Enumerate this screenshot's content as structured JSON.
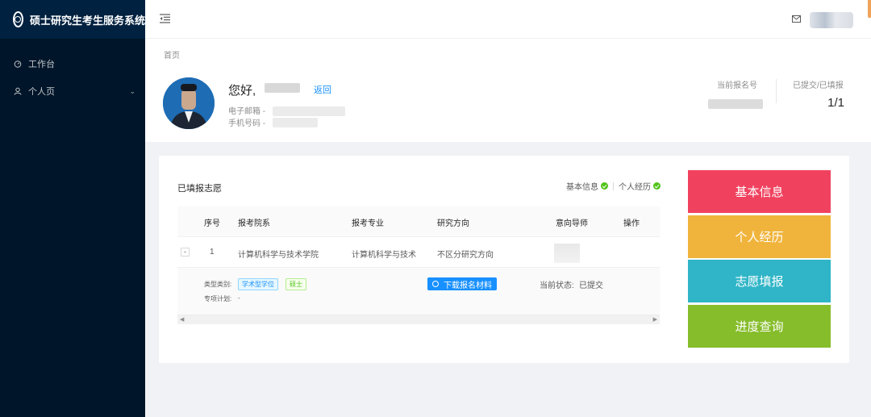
{
  "app": {
    "title": "硕士研究生考生服务系统"
  },
  "sidebar": {
    "items": [
      {
        "label": "工作台",
        "icon": "dashboard-icon"
      },
      {
        "label": "个人页",
        "icon": "user-icon"
      }
    ]
  },
  "header": {
    "breadcrumb": "首页",
    "greeting": "您好,",
    "back_label": "返回",
    "email_label": "电子邮箱 -",
    "phone_label": "手机号码 -",
    "stats": [
      {
        "label": "当前报名号"
      },
      {
        "label": "已提交/已填报",
        "value": "1/1"
      }
    ]
  },
  "card": {
    "title": "已填报志愿",
    "checks": [
      "基本信息",
      "个人经历"
    ],
    "table": {
      "columns": [
        "序号",
        "报考院系",
        "报考专业",
        "研究方向",
        "意向导师",
        "操作"
      ],
      "rows": [
        {
          "expand": "-",
          "index": "1",
          "dept": "计算机科学与技术学院",
          "major": "计算机科学与技术",
          "direction": "不区分研究方向"
        }
      ],
      "detail": {
        "type_label": "类型类别:",
        "tags": [
          "学术型学位",
          "硕士"
        ],
        "plan_label": "专项计划:",
        "plan_value": "-",
        "download_label": "下载报名材料",
        "status_label": "当前状态:",
        "status_value": "已提交"
      }
    }
  },
  "nav_buttons": [
    {
      "label": "基本信息",
      "color": "#f0425f"
    },
    {
      "label": "个人经历",
      "color": "#f0b43c"
    },
    {
      "label": "志愿填报",
      "color": "#2fb5c7"
    },
    {
      "label": "进度查询",
      "color": "#86bd2b"
    }
  ]
}
